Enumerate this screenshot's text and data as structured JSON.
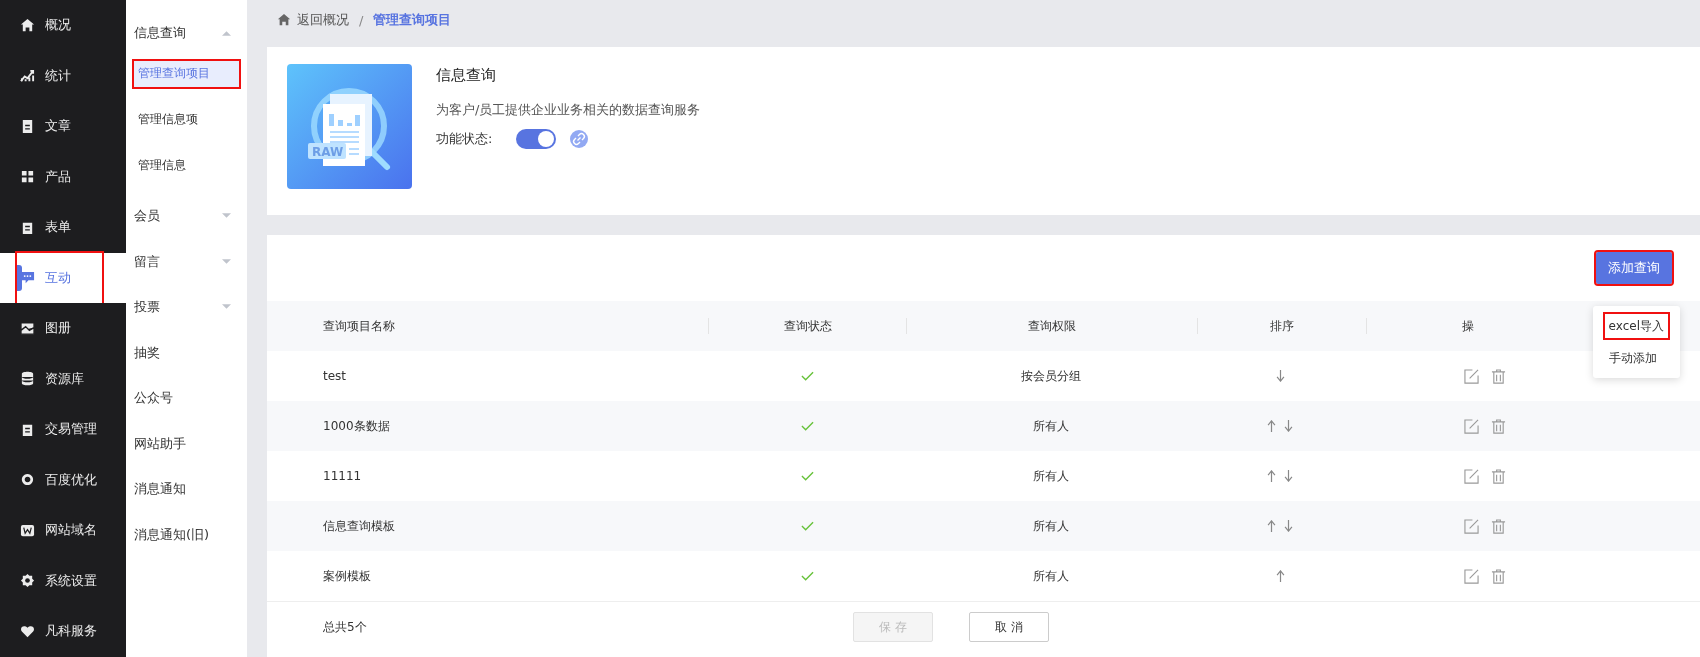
{
  "main_nav": [
    {
      "label": "概况",
      "kind": "home",
      "selected": false,
      "annotated": false
    },
    {
      "label": "统计",
      "kind": "chart",
      "selected": false,
      "annotated": false
    },
    {
      "label": "文章",
      "kind": "doc",
      "selected": false,
      "annotated": false
    },
    {
      "label": "产品",
      "kind": "grid",
      "selected": false,
      "annotated": false
    },
    {
      "label": "表单",
      "kind": "form",
      "selected": false,
      "annotated": false
    },
    {
      "label": "互动",
      "kind": "chat",
      "selected": true,
      "annotated": true
    },
    {
      "label": "图册",
      "kind": "album",
      "selected": false,
      "annotated": false
    },
    {
      "label": "资源库",
      "kind": "db",
      "selected": false,
      "annotated": false
    },
    {
      "label": "交易管理",
      "kind": "form",
      "selected": false,
      "annotated": false
    },
    {
      "label": "百度优化",
      "kind": "ring",
      "selected": false,
      "annotated": false
    },
    {
      "label": "网站域名",
      "kind": "w",
      "selected": false,
      "annotated": false
    },
    {
      "label": "系统设置",
      "kind": "gear",
      "selected": false,
      "annotated": false
    },
    {
      "label": "凡科服务",
      "kind": "heart",
      "selected": false,
      "annotated": false
    }
  ],
  "sub_nav": [
    {
      "label": "信息查询",
      "expanded": true,
      "children": [
        {
          "label": "管理查询项目",
          "selected": true,
          "annotated": true
        },
        {
          "label": "管理信息项",
          "selected": false,
          "annotated": false
        },
        {
          "label": "管理信息",
          "selected": false,
          "annotated": false
        }
      ]
    },
    {
      "label": "会员",
      "expanded": false
    },
    {
      "label": "留言",
      "expanded": false
    },
    {
      "label": "投票",
      "expanded": false
    },
    {
      "label": "抽奖"
    },
    {
      "label": "公众号"
    },
    {
      "label": "网站助手"
    },
    {
      "label": "消息通知"
    },
    {
      "label": "消息通知(旧)"
    }
  ],
  "breadcrumb": {
    "back": "返回概况",
    "separator": "/",
    "current": "管理查询项目"
  },
  "feature": {
    "title": "信息查询",
    "description": "为客户/员工提供企业业务相关的数据查询服务",
    "status_label": "功能状态:",
    "status_on": true,
    "picture_label": "RAW"
  },
  "add_button": {
    "label": "添加查询",
    "annotated": true
  },
  "add_menu": [
    {
      "label": "excel导入",
      "annotated": true
    },
    {
      "label": "手动添加",
      "annotated": false
    }
  ],
  "table": {
    "columns": [
      "查询项目名称",
      "查询状态",
      "查询权限",
      "排序",
      "操"
    ],
    "rows": [
      {
        "name": "test",
        "enabled": true,
        "permission": "按会员分组",
        "can_up": false,
        "can_down": true
      },
      {
        "name": "1000条数据",
        "enabled": true,
        "permission": "所有人",
        "can_up": true,
        "can_down": true
      },
      {
        "name": "11111",
        "enabled": true,
        "permission": "所有人",
        "can_up": true,
        "can_down": true
      },
      {
        "name": "信息查询模板",
        "enabled": true,
        "permission": "所有人",
        "can_up": true,
        "can_down": true
      },
      {
        "name": "案例模板",
        "enabled": true,
        "permission": "所有人",
        "can_up": true,
        "can_down": false
      }
    ]
  },
  "footer": {
    "total": "总共5个",
    "save": {
      "label": "保 存",
      "disabled": true
    },
    "cancel": {
      "label": "取 消",
      "disabled": false
    }
  }
}
